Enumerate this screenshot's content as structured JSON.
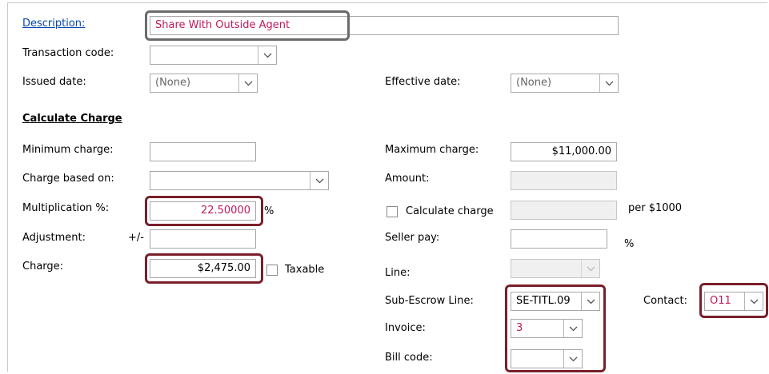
{
  "fields": {
    "description_label": "Description:",
    "description_value": "Share With Outside Agent",
    "transaction_code_label": "Transaction code:",
    "transaction_code_value": "",
    "issued_date_label": "Issued date:",
    "issued_date_value": "(None)",
    "effective_date_label": "Effective date:",
    "effective_date_value": "(None)"
  },
  "calculate": {
    "section_title": "Calculate Charge",
    "minimum_charge_label": "Minimum charge:",
    "minimum_charge_value": "",
    "maximum_charge_label": "Maximum charge:",
    "maximum_charge_value": "$11,000.00",
    "charge_based_on_label": "Charge based on:",
    "charge_based_on_value": "",
    "amount_label": "Amount:",
    "amount_value": "",
    "multiplication_label": "Multiplication %:",
    "multiplication_value": "22.50000",
    "percent_suffix": "%",
    "calculate_charge_label": "Calculate charge",
    "per_label": "per $1000",
    "adjustment_label": "Adjustment:",
    "adjustment_sign": "+/-",
    "adjustment_value": "",
    "seller_pay_label": "Seller pay:",
    "seller_pay_value": "",
    "seller_pay_suffix": "%",
    "charge_label": "Charge:",
    "charge_value": "$2,475.00",
    "taxable_label": "Taxable",
    "line_label": "Line:",
    "line_value": "",
    "sub_escrow_label": "Sub-Escrow Line:",
    "sub_escrow_value": "SE-TITL.09",
    "contact_label": "Contact:",
    "contact_value": "O11",
    "invoice_label": "Invoice:",
    "invoice_value": "3",
    "bill_code_label": "Bill code:",
    "bill_code_value": ""
  },
  "colors": {
    "highlight": "#7a1f2b",
    "highlight_gray": "#6b6b6b",
    "value_red": "#c2185b",
    "link": "#0645ad"
  }
}
